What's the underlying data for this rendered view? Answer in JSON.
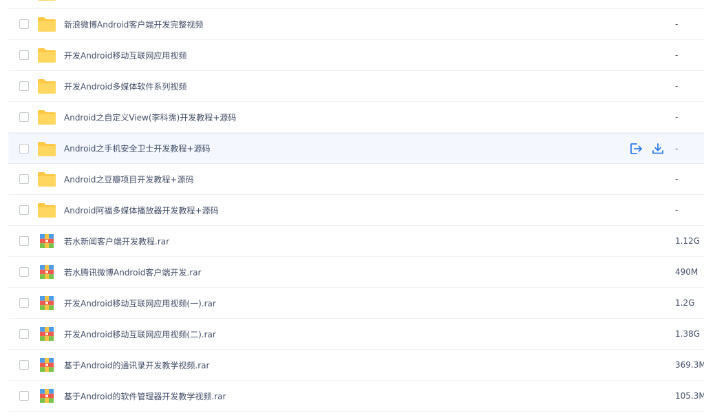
{
  "colors": {
    "folder": "#ffc947",
    "folder_tab": "#f7b731",
    "accent_action": "#2f79ea",
    "text": "#424e67",
    "row_hover_bg": "#f4f8fe"
  },
  "files": [
    {
      "name": "",
      "size": "",
      "type": "folder"
    },
    {
      "name": "新浪微博Android客户端开发完整视频",
      "size": "-",
      "type": "folder"
    },
    {
      "name": "开发Android移动互联网应用视频",
      "size": "-",
      "type": "folder"
    },
    {
      "name": "开发Android多媒体软件系列视频",
      "size": "-",
      "type": "folder"
    },
    {
      "name": "Android之自定义View(李科霈)开发教程+源码",
      "size": "-",
      "type": "folder"
    },
    {
      "name": "Android之手机安全卫士开发教程+源码",
      "size": "-",
      "type": "folder",
      "hovered": true
    },
    {
      "name": "Android之豆瓣项目开发教程+源码",
      "size": "-",
      "type": "folder"
    },
    {
      "name": "Android阿福多媒体播放器开发教程+源码",
      "size": "-",
      "type": "folder"
    },
    {
      "name": "若水新闻客户端开发教程.rar",
      "size": "1.12G",
      "type": "rar"
    },
    {
      "name": "若水腾讯微博Android客户端开发.rar",
      "size": "490M",
      "type": "rar"
    },
    {
      "name": "开发Android移动互联网应用视频(一).rar",
      "size": "1.2G",
      "type": "rar"
    },
    {
      "name": "开发Android移动互联网应用视频(二).rar",
      "size": "1.38G",
      "type": "rar"
    },
    {
      "name": "基于Android的通讯录开发教学视频.rar",
      "size": "369.3M",
      "type": "rar"
    },
    {
      "name": "基于Android的软件管理器开发教学视频.rar",
      "size": "105.3M",
      "type": "rar"
    }
  ],
  "row_actions": {
    "share_icon": "share-icon",
    "download_icon": "download-icon"
  }
}
